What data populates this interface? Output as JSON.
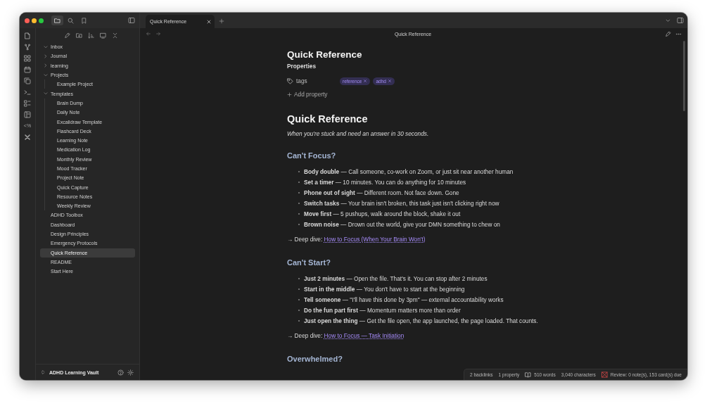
{
  "window": {
    "title": "Quick Reference"
  },
  "tabs": [
    {
      "label": "Quick Reference",
      "selected": true
    }
  ],
  "ribbon": {
    "templater_label": "<%"
  },
  "sidebar": {
    "tree": [
      {
        "label": "Inbox",
        "kind": "folder",
        "expanded": true,
        "selected": false
      },
      {
        "label": "Journal",
        "kind": "folder",
        "expanded": false,
        "selected": false
      },
      {
        "label": "learning",
        "kind": "folder",
        "expanded": false,
        "selected": false
      },
      {
        "label": "Projects",
        "kind": "folder",
        "expanded": true,
        "selected": false,
        "children": [
          {
            "label": "Example Project",
            "kind": "file",
            "selected": false
          }
        ]
      },
      {
        "label": "Templates",
        "kind": "folder",
        "expanded": true,
        "selected": false,
        "children": [
          {
            "label": "Brain Dump",
            "kind": "file",
            "selected": false
          },
          {
            "label": "Daily Note",
            "kind": "file",
            "selected": false
          },
          {
            "label": "Excalidraw Template",
            "kind": "file",
            "selected": false
          },
          {
            "label": "Flashcard Deck",
            "kind": "file",
            "selected": false
          },
          {
            "label": "Learning Note",
            "kind": "file",
            "selected": false
          },
          {
            "label": "Medication Log",
            "kind": "file",
            "selected": false
          },
          {
            "label": "Monthly Review",
            "kind": "file",
            "selected": false
          },
          {
            "label": "Mood Tracker",
            "kind": "file",
            "selected": false
          },
          {
            "label": "Project Note",
            "kind": "file",
            "selected": false
          },
          {
            "label": "Quick Capture",
            "kind": "file",
            "selected": false
          },
          {
            "label": "Resource Notes",
            "kind": "file",
            "selected": false
          },
          {
            "label": "Weekly Review",
            "kind": "file",
            "selected": false
          }
        ]
      },
      {
        "label": "ADHD Toolbox",
        "kind": "file",
        "selected": false
      },
      {
        "label": "Dashboard",
        "kind": "file",
        "selected": false
      },
      {
        "label": "Design Principles",
        "kind": "file",
        "selected": false
      },
      {
        "label": "Emergency Protocols",
        "kind": "file",
        "selected": false
      },
      {
        "label": "Quick Reference",
        "kind": "file",
        "selected": true
      },
      {
        "label": "README",
        "kind": "file",
        "selected": false
      },
      {
        "label": "Start Here",
        "kind": "file",
        "selected": false
      }
    ],
    "vault_name": "ADHD Learning Vault"
  },
  "note": {
    "title": "Quick Reference",
    "properties_label": "Properties",
    "properties": [
      {
        "name": "tags",
        "values": [
          "reference",
          "adhd"
        ]
      }
    ],
    "add_property": "Add property",
    "heading": "Quick Reference",
    "intro": "When you're stuck and need an answer in 30 seconds.",
    "sections": [
      {
        "heading": "Can't Focus?",
        "items": [
          "**Body double** — Call someone, co-work on Zoom, or just sit near another human",
          "**Set a timer** — 10 minutes. You can do anything for 10 minutes",
          "**Phone out of sight** — Different room. Not face down. Gone",
          "**Switch tasks** — Your brain isn't broken, this task just isn't clicking right now",
          "**Move first** — 5 pushups, walk around the block, shake it out",
          "**Brown noise** — Drown out the world, give your DMN something to chew on"
        ],
        "deep_dive": {
          "label": "→ Deep dive:",
          "link": "How to Focus (When Your Brain Won't)"
        }
      },
      {
        "heading": "Can't Start?",
        "items": [
          "**Just 2 minutes** — Open the file. That's it. You can stop after 2 minutes",
          "**Start in the middle** — You don't have to start at the beginning",
          "**Tell someone** — \"I'll have this done by 3pm\" — external accountability works",
          "**Do the fun part first** — Momentum matters more than order",
          "**Just open the thing** — Get the file open, the app launched, the page loaded. That counts."
        ],
        "deep_dive": {
          "label": "→ Deep dive:",
          "link": "How to Focus — Task Initiation"
        }
      },
      {
        "heading": "Overwhelmed?"
      }
    ]
  },
  "status_bar": {
    "backlinks": "2 backlinks",
    "properties": "1 property",
    "words": "510 words",
    "characters": "3,040 characters",
    "review": "Review: 0 note(s), 153 card(s) due"
  }
}
